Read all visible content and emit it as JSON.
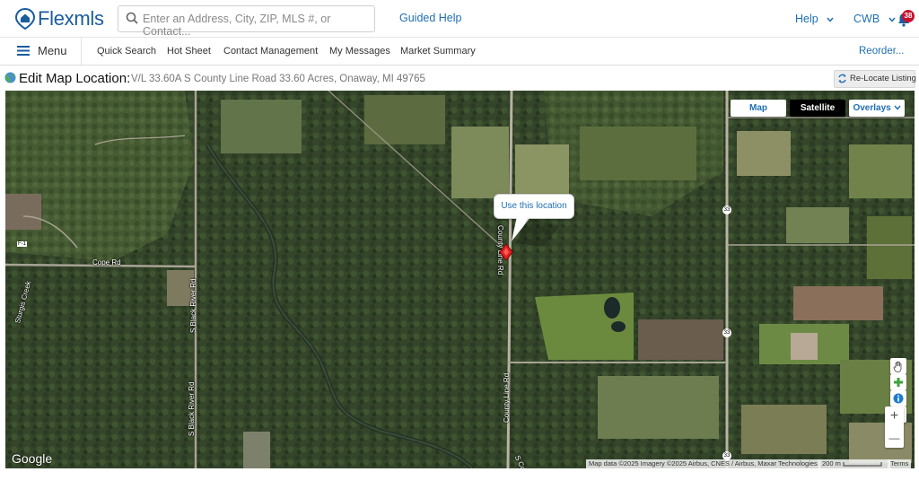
{
  "topbar": {
    "logo_text": "Flexmls",
    "search_placeholder": "Enter an Address, City, ZIP, MLS #, or Contact...",
    "guided_help": "Guided Help",
    "help_label": "Help",
    "user_label": "CWB",
    "notification_count": "38"
  },
  "navbar": {
    "menu_label": "Menu",
    "links": [
      "Quick Search",
      "Hot Sheet",
      "Contact Management",
      "My Messages",
      "Market Summary"
    ],
    "reorder": "Reorder..."
  },
  "subheader": {
    "title": "Edit Map Location:",
    "address": "V/L 33.60A S County Line Road 33.60 Acres, Onaway, MI 49765",
    "relocate_label": "Re-Locate Listing"
  },
  "map": {
    "type_buttons": {
      "map": "Map",
      "satellite": "Satellite",
      "overlays": "Overlays"
    },
    "selected_type": "Satellite",
    "marker_tooltip": "Use this location",
    "roads": {
      "cope_rd": "Cope Rd",
      "black_river_top": "S Black River Rd",
      "black_river_bottom": "S Black River Rd",
      "county_line_top": "County Line Rd",
      "county_line_bottom": "County Line Rd",
      "county_line_partial": "S Co",
      "sturgis": "Sturgis Creek",
      "f1": "F-1"
    },
    "route_shield": "33",
    "google_logo": "Google",
    "attribution": "Map data ©2025 Imagery ©2025 Airbus, CNES / Airbus, Maxar Technologies",
    "scale": "200 m",
    "terms": "Terms",
    "zoom_in": "+",
    "zoom_out": "—"
  },
  "colors": {
    "brand_blue": "#1a5c9e",
    "link_blue": "#1f6fb2",
    "badge_red": "#c8102e",
    "marker_red": "#e02020"
  },
  "icons": [
    "flexmls-logo-icon",
    "search-icon",
    "chevron-down-icon",
    "bell-icon",
    "hamburger-icon",
    "globe-icon",
    "relocate-icon",
    "map-marker-icon",
    "pan-hand-icon",
    "add-point-icon",
    "info-icon",
    "measure-icon"
  ]
}
